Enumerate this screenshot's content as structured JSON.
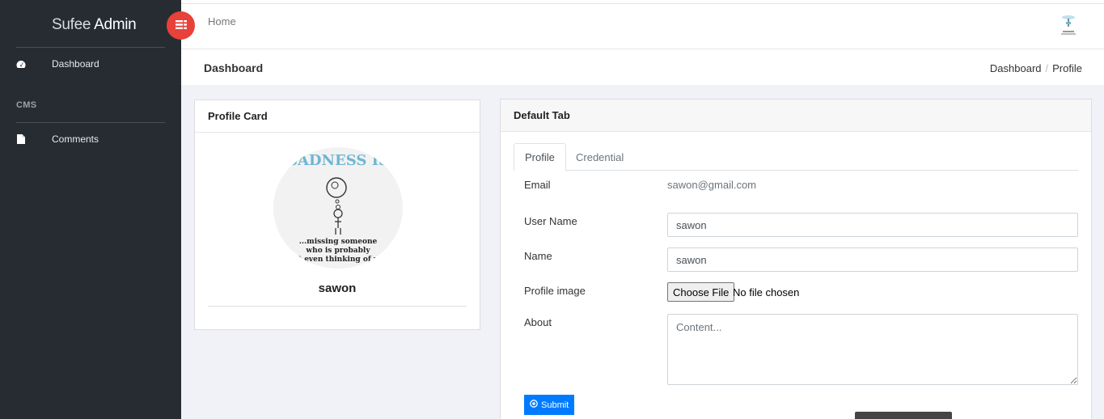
{
  "sidebar": {
    "brand_light": "Sufee",
    "brand_bold": "Admin",
    "items": [
      {
        "label": "Dashboard",
        "icon": "dashboard-icon"
      },
      {
        "label": "Comments",
        "icon": "file-icon"
      }
    ],
    "section_title": "CMS"
  },
  "header": {
    "home_label": "Home",
    "user_icon": "user-avatar-icon"
  },
  "page": {
    "title": "Dashboard",
    "breadcrumb": [
      "Dashboard",
      "Profile"
    ]
  },
  "profile_card": {
    "title": "Profile Card",
    "image_caption": [
      "SADNESS IS",
      "...missing someone",
      "who is probably",
      "not even thinking of you"
    ],
    "name": "sawon"
  },
  "default_tab": {
    "title": "Default Tab",
    "tabs": [
      "Profile",
      "Credential"
    ],
    "active_tab": "Profile",
    "email_label": "Email",
    "email_value": "sawon@gmail.com",
    "username_label": "User Name",
    "username_value": "sawon",
    "name_label": "Name",
    "name_value": "sawon",
    "image_label": "Profile image",
    "file_button": "Choose File",
    "file_status": "No file chosen",
    "about_label": "About",
    "about_placeholder": "Content...",
    "submit_label": "Submit"
  },
  "colors": {
    "sidebar_bg": "#272c33",
    "toggle_red": "#e8413a",
    "primary_blue": "#007bff",
    "page_bg": "#f1f2f7"
  }
}
